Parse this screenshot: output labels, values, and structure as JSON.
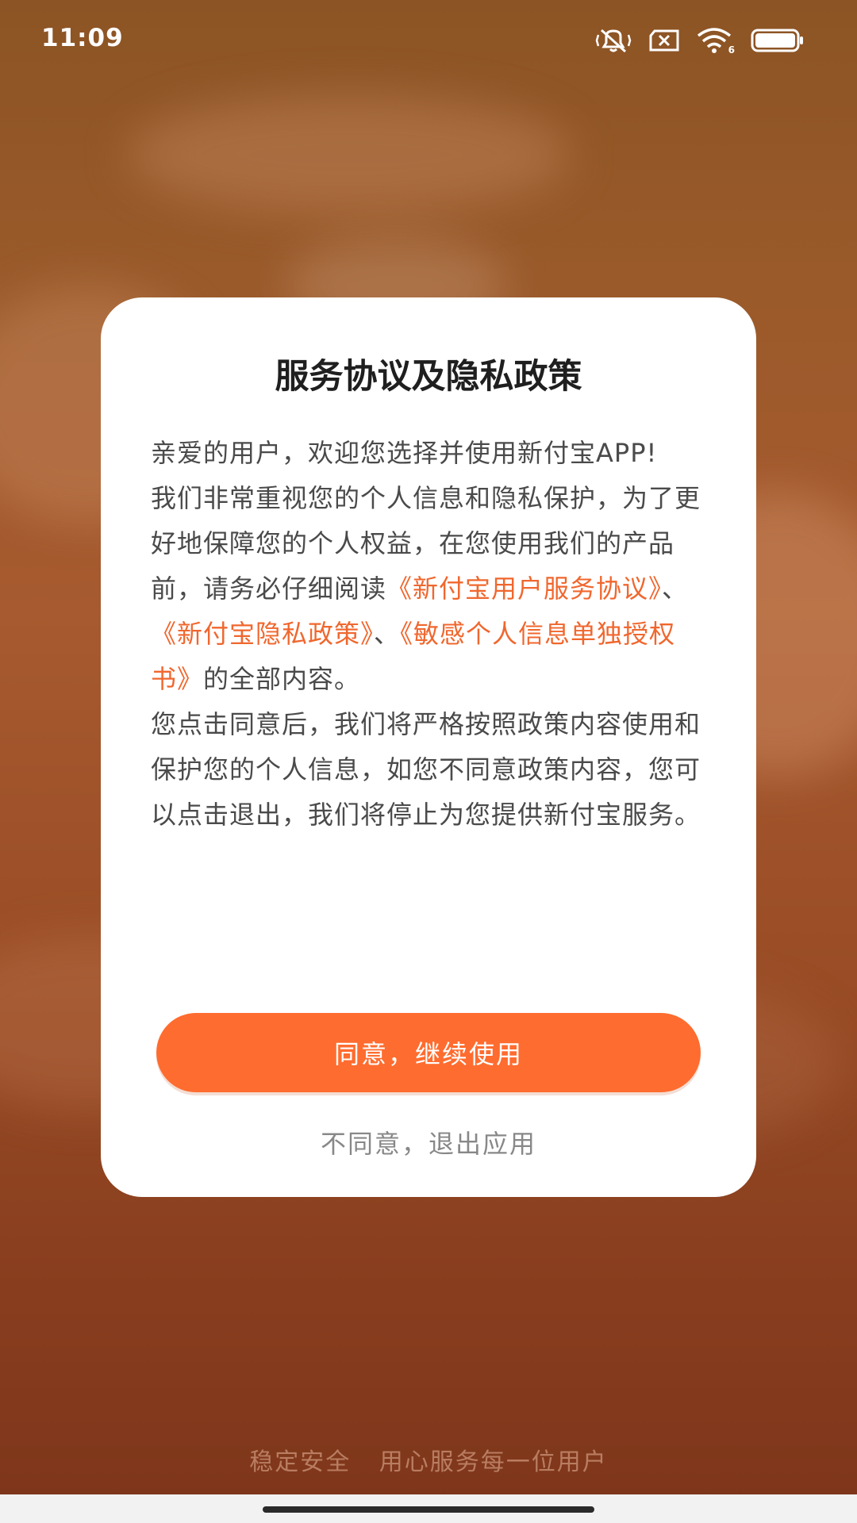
{
  "status_bar": {
    "time": "11:09",
    "icons": [
      "vibrate-mute-icon",
      "no-sim-icon",
      "wifi-icon",
      "battery-icon"
    ],
    "wifi_badge": "6"
  },
  "dialog": {
    "title": "服务协议及隐私政策",
    "greeting": "亲爱的用户，欢迎您选择并使用新付宝APP!",
    "para1_lead": "我们非常重视您的个人信息和隐私保护，为了更好地保障您的个人权益，在您使用我们的产品前，请务必仔细阅读",
    "link_service": "《新付宝用户服务协议》",
    "sep1": "、",
    "link_privacy": "《新付宝隐私政策》",
    "sep2": "、",
    "link_auth": "《敏感个人信息单独授权书》",
    "para1_tail": "的全部内容。",
    "para2": "您点击同意后，我们将严格按照政策内容使用和保护您的个人信息，如您不同意政策内容，您可以点击退出，我们将停止为您提供新付宝服务。",
    "agree_label": "同意，继续使用",
    "disagree_label": "不同意，退出应用"
  },
  "footer": {
    "slogan": "稳定安全 用心服务每一位用户"
  },
  "colors": {
    "accent": "#ff6c2f",
    "link": "#f0672e",
    "background": "#9a5a2a"
  }
}
